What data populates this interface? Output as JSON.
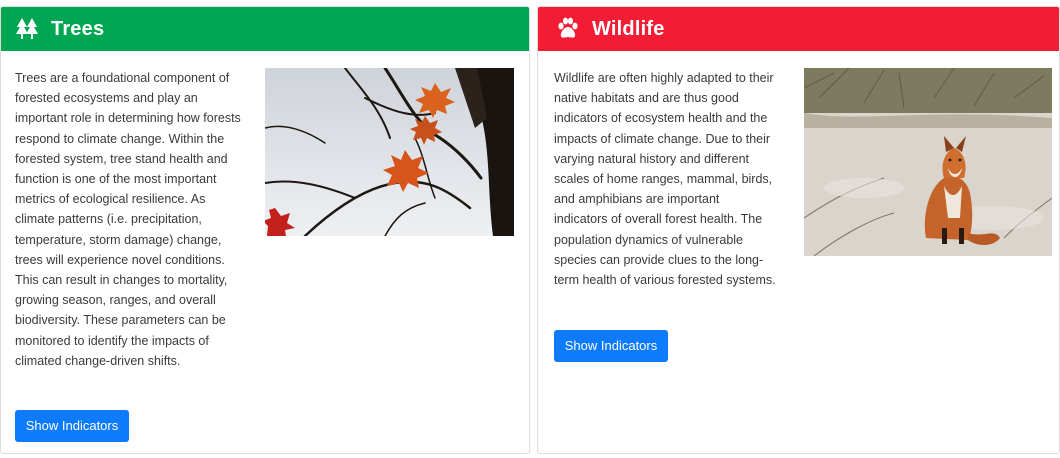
{
  "trees": {
    "title": "Trees",
    "icon": "trees-icon",
    "header_color": "#00a651",
    "description": "Trees are a foundational component of forested ecosystems and play an important role in determining how forests respond to climate change. Within the forested system, tree stand health and function is one of the most important metrics of ecological resilience. As climate patterns (i.e. precipitation, temperature, storm damage) change, trees will experience novel conditions. This can result in changes to mortality, growing season, ranges, and overall biodiversity. These parameters can be monitored to identify the impacts of climated change-driven shifts.",
    "button_label": "Show Indicators",
    "image": "maple-leaves-photo"
  },
  "wildlife": {
    "title": "Wildlife",
    "icon": "paw-icon",
    "header_color": "#f21d35",
    "description": "Wildlife are often highly adapted to their native habitats and are thus good indicators of ecosystem health and the impacts of climate change. Due to their varying natural history and different scales of home ranges, mammal, birds, and amphibians are important indicators of overall forest health. The population dynamics of vulnerable species can provide clues to the long-term health of various forested systems.",
    "button_label": "Show Indicators",
    "image": "red-fox-photo"
  },
  "button_color": "#0d7bfc"
}
